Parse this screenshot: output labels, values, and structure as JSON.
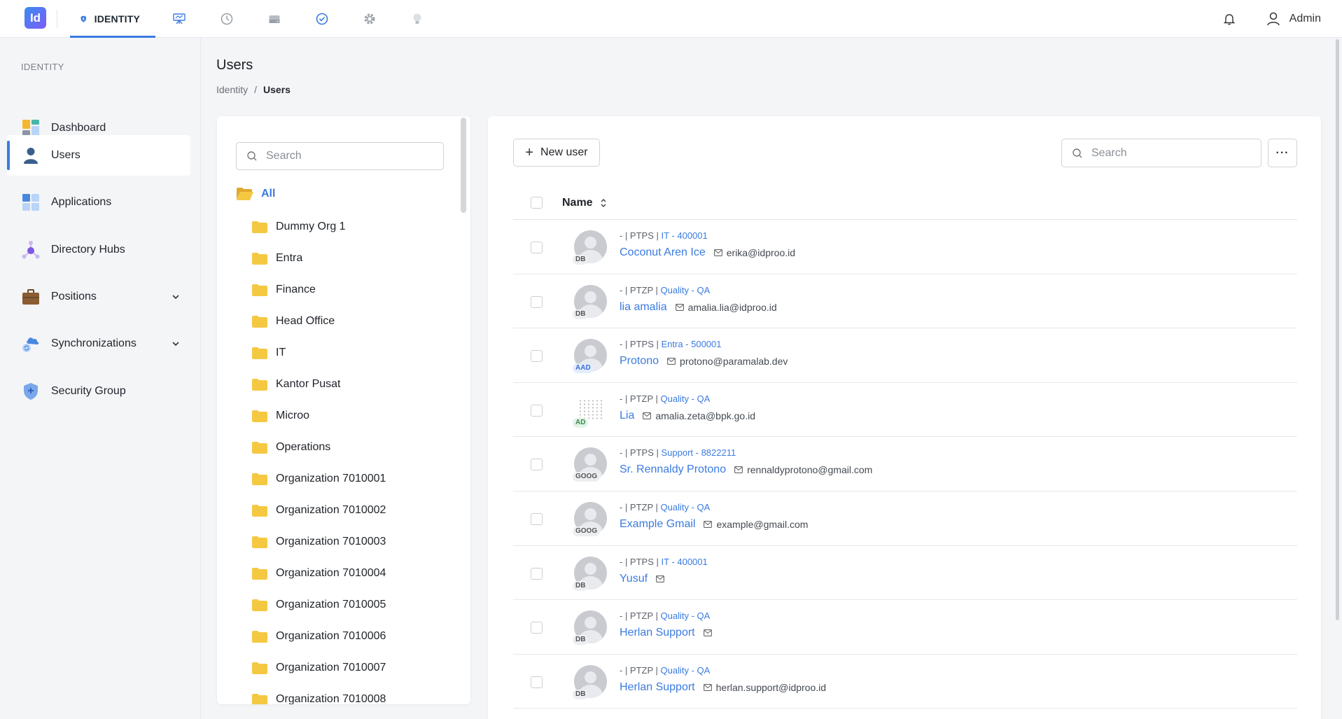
{
  "app": {
    "logo_text": "Id"
  },
  "topnav": {
    "active_tab": "IDENTITY",
    "icons": [
      "shield-icon",
      "presentation-icon",
      "clock-icon",
      "drive-icon",
      "check-circle-icon",
      "gear-icon",
      "bulb-icon"
    ]
  },
  "header": {
    "admin_label": "Admin"
  },
  "sidebar": {
    "section": "IDENTITY",
    "items": [
      {
        "label": "Dashboard",
        "icon": "dashboard-icon"
      },
      {
        "label": "Users",
        "icon": "user-icon",
        "active": true
      },
      {
        "label": "Applications",
        "icon": "applications-icon"
      },
      {
        "label": "Directory Hubs",
        "icon": "hub-icon"
      },
      {
        "label": "Positions",
        "icon": "briefcase-icon",
        "expandable": true
      },
      {
        "label": "Synchronizations",
        "icon": "cloud-sync-icon",
        "expandable": true
      },
      {
        "label": "Security Group",
        "icon": "shield-plus-icon"
      }
    ]
  },
  "page": {
    "title": "Users",
    "breadcrumb": [
      "Identity",
      "Users"
    ]
  },
  "tree": {
    "search_placeholder": "Search",
    "root_label": "All",
    "nodes": [
      "Dummy Org 1",
      "Entra",
      "Finance",
      "Head Office",
      "IT",
      "Kantor Pusat",
      "Microo",
      "Operations",
      "Organization 7010001",
      "Organization 7010002",
      "Organization 7010003",
      "Organization 7010004",
      "Organization 7010005",
      "Organization 7010006",
      "Organization 7010007",
      "Organization 7010008"
    ]
  },
  "users_panel": {
    "new_user_label": "New user",
    "search_placeholder": "Search",
    "more_label": "···",
    "column_name": "Name",
    "users": [
      {
        "prefix": "- | PTPS | ",
        "org": "IT - 400001",
        "name": "Coconut Aren Ice",
        "email": "erika@idproo.id",
        "source": "DB",
        "avatar": "default"
      },
      {
        "prefix": "- | PTZP | ",
        "org": "Quality - QA",
        "name": "lia amalia",
        "email": "amalia.lia@idproo.id",
        "source": "DB",
        "avatar": "default"
      },
      {
        "prefix": "- | PTPS | ",
        "org": "Entra - 500001",
        "name": "Protono",
        "email": "protono@paramalab.dev",
        "source": "AAD",
        "avatar": "default"
      },
      {
        "prefix": "- | PTZP | ",
        "org": "Quality - QA",
        "name": "Lia",
        "email": "amalia.zeta@bpk.go.id",
        "source": "AD",
        "avatar": "photo"
      },
      {
        "prefix": "- | PTPS | ",
        "org": "Support - 8822211",
        "name": "Sr. Rennaldy Protono",
        "email": "rennaldyprotono@gmail.com",
        "source": "GOOG",
        "avatar": "default"
      },
      {
        "prefix": "- | PTZP | ",
        "org": "Quality - QA",
        "name": "Example Gmail",
        "email": "example@gmail.com",
        "source": "GOOG",
        "avatar": "default"
      },
      {
        "prefix": "- | PTPS | ",
        "org": "IT - 400001",
        "name": "Yusuf",
        "email": "",
        "source": "DB",
        "avatar": "default"
      },
      {
        "prefix": "- | PTZP | ",
        "org": "Quality - QA",
        "name": "Herlan Support",
        "email": "",
        "source": "DB",
        "avatar": "default"
      },
      {
        "prefix": "- | PTZP | ",
        "org": "Quality - QA",
        "name": "Herlan Support",
        "email": "herlan.support@idproo.id",
        "source": "DB",
        "avatar": "default"
      }
    ]
  },
  "colors": {
    "accent": "#3b7be0",
    "folder": "#f5c842"
  }
}
